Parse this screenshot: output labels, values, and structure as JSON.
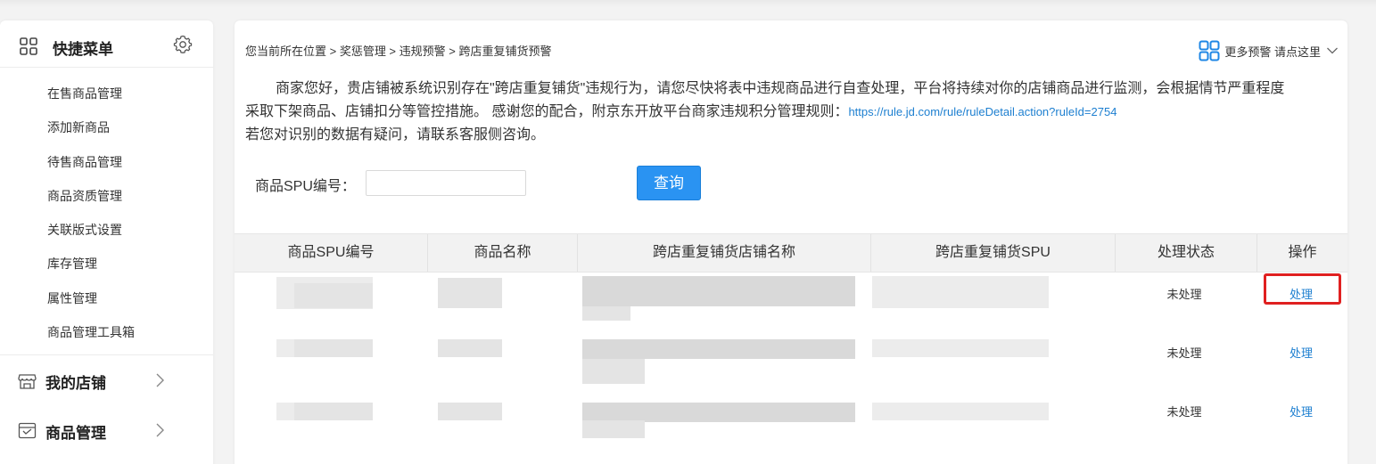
{
  "sidebar": {
    "title": "快捷菜单",
    "items": [
      {
        "label": "在售商品管理"
      },
      {
        "label": "添加新商品"
      },
      {
        "label": "待售商品管理"
      },
      {
        "label": "商品资质管理"
      },
      {
        "label": "关联版式设置"
      },
      {
        "label": "库存管理"
      },
      {
        "label": "属性管理"
      },
      {
        "label": "商品管理工具箱"
      }
    ],
    "groups": [
      {
        "label": "我的店铺",
        "icon": "store-icon"
      },
      {
        "label": "商品管理",
        "icon": "goods-icon"
      }
    ]
  },
  "breadcrumb": "您当前所在位置 > 奖惩管理 > 违规预警 > 跨店重复铺货预警",
  "more_link": "更多预警 请点这里",
  "notice": {
    "line1": "商家您好，贵店铺被系统识别存在\"跨店重复铺货\"违规行为，请您尽快将表中违规商品进行自查处理，平台将持续对你的店铺商品进行监测，会根据情节严重程度",
    "line2": "采取下架商品、店铺扣分等管控措施。 感谢您的配合，附京东开放平台商家违规积分管理规则：",
    "link": "https://rule.jd.com/rule/ruleDetail.action?ruleId=2754",
    "line3": "若您对识别的数据有疑问，请联系客服侧咨询。"
  },
  "search": {
    "label": "商品SPU编号：",
    "value": "",
    "button": "查询"
  },
  "table": {
    "headers": [
      "商品SPU编号",
      "商品名称",
      "跨店重复铺货店铺名称",
      "跨店重复铺货SPU",
      "处理状态",
      "操作"
    ],
    "rows": [
      {
        "status": "未处理",
        "action": "处理"
      },
      {
        "status": "未处理",
        "action": "处理"
      },
      {
        "status": "未处理",
        "action": "处理"
      }
    ]
  },
  "colors": {
    "accent": "#2a93f2",
    "link": "#1d7fd0",
    "highlight": "#e02020"
  }
}
